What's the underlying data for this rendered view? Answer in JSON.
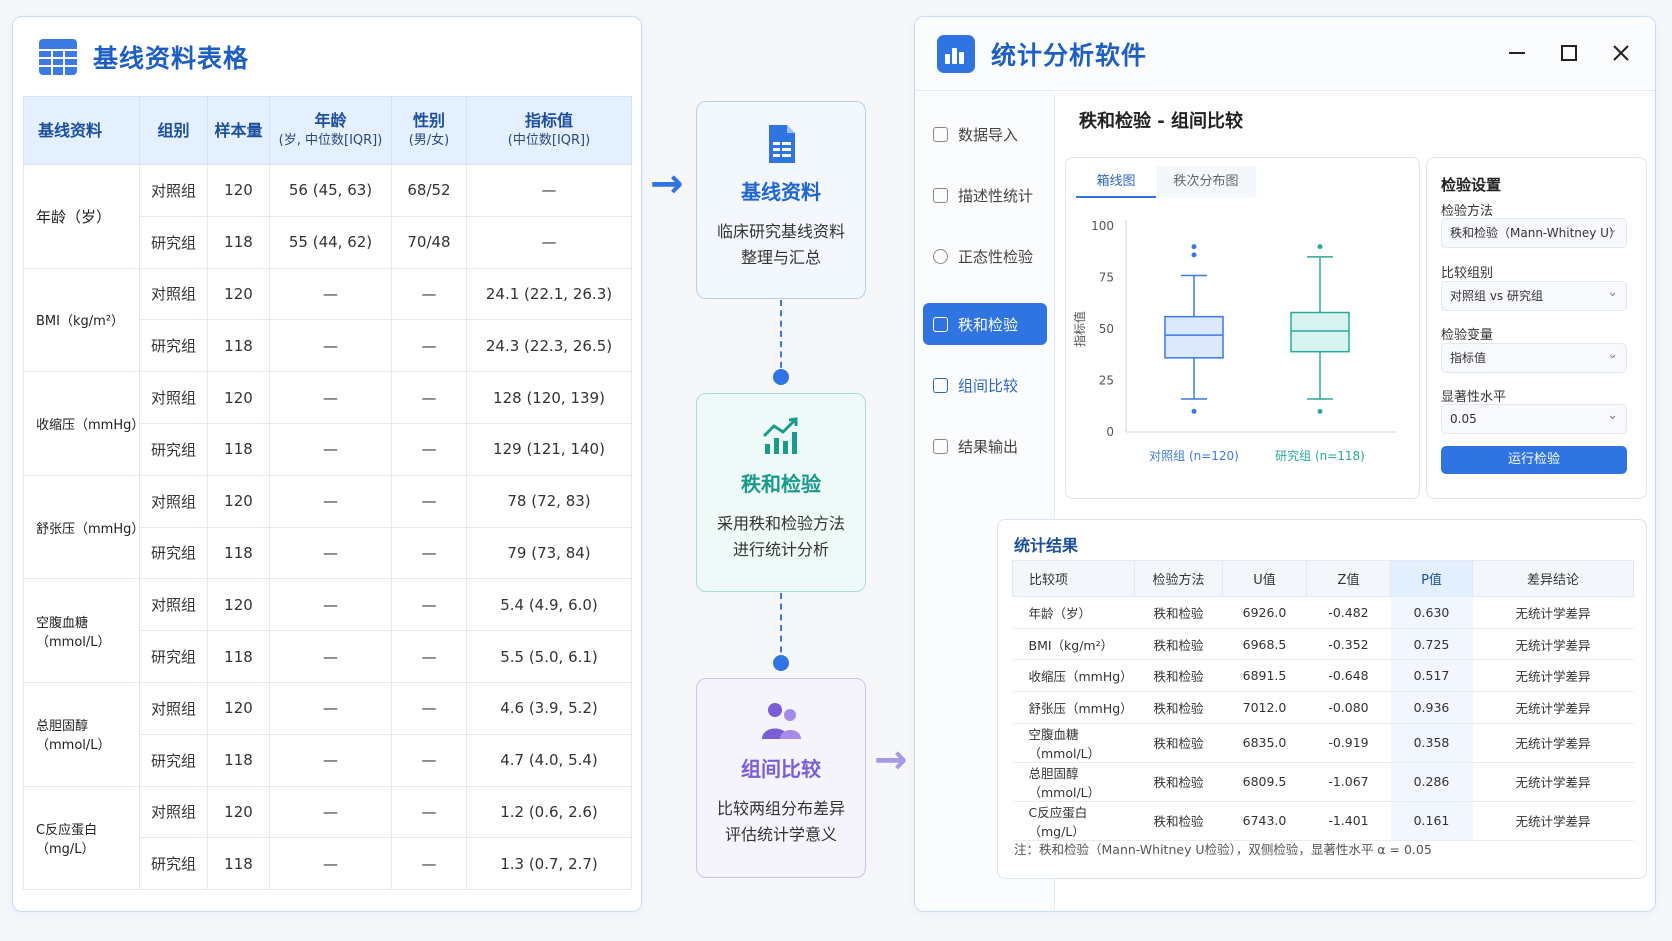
{
  "left": {
    "title": "基线资料表格",
    "headers": [
      {
        "main": "基线资料",
        "sub": ""
      },
      {
        "main": "组别",
        "sub": ""
      },
      {
        "main": "样本量",
        "sub": ""
      },
      {
        "main": "年龄",
        "sub": "(岁, 中位数[IQR])"
      },
      {
        "main": "性别",
        "sub": "(男/女)"
      },
      {
        "main": "指标值",
        "sub": "(中位数[IQR])"
      }
    ],
    "rows": [
      {
        "var": "年龄（岁）",
        "cells": [
          [
            "对照组",
            "120",
            "56 (45, 63)",
            "68/52",
            "—"
          ],
          [
            "研究组",
            "118",
            "55 (44, 62)",
            "70/48",
            "—"
          ]
        ]
      },
      {
        "var": "BMI（kg/m²）",
        "cells": [
          [
            "对照组",
            "120",
            "—",
            "—",
            "24.1 (22.1, 26.3)"
          ],
          [
            "研究组",
            "118",
            "—",
            "—",
            "24.3 (22.3, 26.5)"
          ]
        ]
      },
      {
        "var": "收缩压（mmHg）",
        "cells": [
          [
            "对照组",
            "120",
            "—",
            "—",
            "128 (120, 139)"
          ],
          [
            "研究组",
            "118",
            "—",
            "—",
            "129 (121, 140)"
          ]
        ]
      },
      {
        "var": "舒张压（mmHg）",
        "cells": [
          [
            "对照组",
            "120",
            "—",
            "—",
            "78 (72, 83)"
          ],
          [
            "研究组",
            "118",
            "—",
            "—",
            "79 (73, 84)"
          ]
        ]
      },
      {
        "var": "空腹血糖（mmol/L）",
        "cells": [
          [
            "对照组",
            "120",
            "—",
            "—",
            "5.4 (4.9, 6.0)"
          ],
          [
            "研究组",
            "118",
            "—",
            "—",
            "5.5 (5.0, 6.1)"
          ]
        ]
      },
      {
        "var": "总胆固醇（mmol/L）",
        "cells": [
          [
            "对照组",
            "120",
            "—",
            "—",
            "4.6 (3.9, 5.2)"
          ],
          [
            "研究组",
            "118",
            "—",
            "—",
            "4.7 (4.0, 5.4)"
          ]
        ]
      },
      {
        "var": "C反应蛋白（mg/L）",
        "cells": [
          [
            "对照组",
            "120",
            "—",
            "—",
            "1.2 (0.6, 2.6)"
          ],
          [
            "研究组",
            "118",
            "—",
            "—",
            "1.3 (0.7, 2.7)"
          ]
        ]
      }
    ]
  },
  "flow": {
    "step1": {
      "title": "基线资料",
      "line1": "临床研究基线资料",
      "line2": "整理与汇总"
    },
    "step2": {
      "title": "秩和检验",
      "line1": "采用秩和检验方法",
      "line2": "进行统计分析"
    },
    "step3": {
      "title": "组间比较",
      "line1": "比较两组分布差异",
      "line2": "评估统计学意义"
    }
  },
  "window": {
    "title": "统计分析软件",
    "nav": [
      "数据导入",
      "描述性统计",
      "正态性检验",
      "秩和检验",
      "组间比较",
      "结果输出"
    ],
    "section_title": "秩和检验 - 组间比较",
    "tabs": [
      "箱线图",
      "秩次分布图"
    ],
    "settings": {
      "title": "检验设置",
      "method_label": "检验方法",
      "method_value": "秩和检验（Mann-Whitney U）",
      "group_label": "比较组别",
      "group_value": "对照组   vs   研究组",
      "var_label": "检验变量",
      "var_value": "指标值",
      "alpha_label": "显著性水平",
      "alpha_value": "0.05",
      "run_label": "运行检验"
    },
    "results": {
      "title": "统计结果",
      "headers": [
        "比较项",
        "检验方法",
        "U值",
        "Z值",
        "P值",
        "差异结论"
      ],
      "rows": [
        [
          "年龄（岁）",
          "秩和检验",
          "6926.0",
          "-0.482",
          "0.630",
          "无统计学差异"
        ],
        [
          "BMI（kg/m²）",
          "秩和检验",
          "6968.5",
          "-0.352",
          "0.725",
          "无统计学差异"
        ],
        [
          "收缩压（mmHg）",
          "秩和检验",
          "6891.5",
          "-0.648",
          "0.517",
          "无统计学差异"
        ],
        [
          "舒张压（mmHg）",
          "秩和检验",
          "7012.0",
          "-0.080",
          "0.936",
          "无统计学差异"
        ],
        [
          "空腹血糖（mmol/L）",
          "秩和检验",
          "6835.0",
          "-0.919",
          "0.358",
          "无统计学差异"
        ],
        [
          "总胆固醇（mmol/L）",
          "秩和检验",
          "6809.5",
          "-1.067",
          "0.286",
          "无统计学差异"
        ],
        [
          "C反应蛋白（mg/L）",
          "秩和检验",
          "6743.0",
          "-1.401",
          "0.161",
          "无统计学差异"
        ]
      ],
      "note": "注：秩和检验（Mann-Whitney U检验），双侧检验，显著性水平 α = 0.05"
    }
  },
  "chart_data": {
    "type": "boxplot",
    "ylabel": "指标值",
    "ylim": [
      0,
      100
    ],
    "yticks": [
      0,
      25,
      50,
      75,
      100
    ],
    "groups": [
      {
        "name": "对照组 (n=120)",
        "color": "#3a7ae0",
        "fill": "#dce8fb",
        "whisker_low": 16,
        "q1": 36,
        "median": 47,
        "q3": 56,
        "whisker_high": 76,
        "outliers": [
          10,
          86,
          90
        ]
      },
      {
        "name": "研究组 (n=118)",
        "color": "#2aa89a",
        "fill": "#d8f3ef",
        "whisker_low": 16,
        "q1": 39,
        "median": 49,
        "q3": 58,
        "whisker_high": 85,
        "outliers": [
          10,
          90
        ]
      }
    ]
  }
}
